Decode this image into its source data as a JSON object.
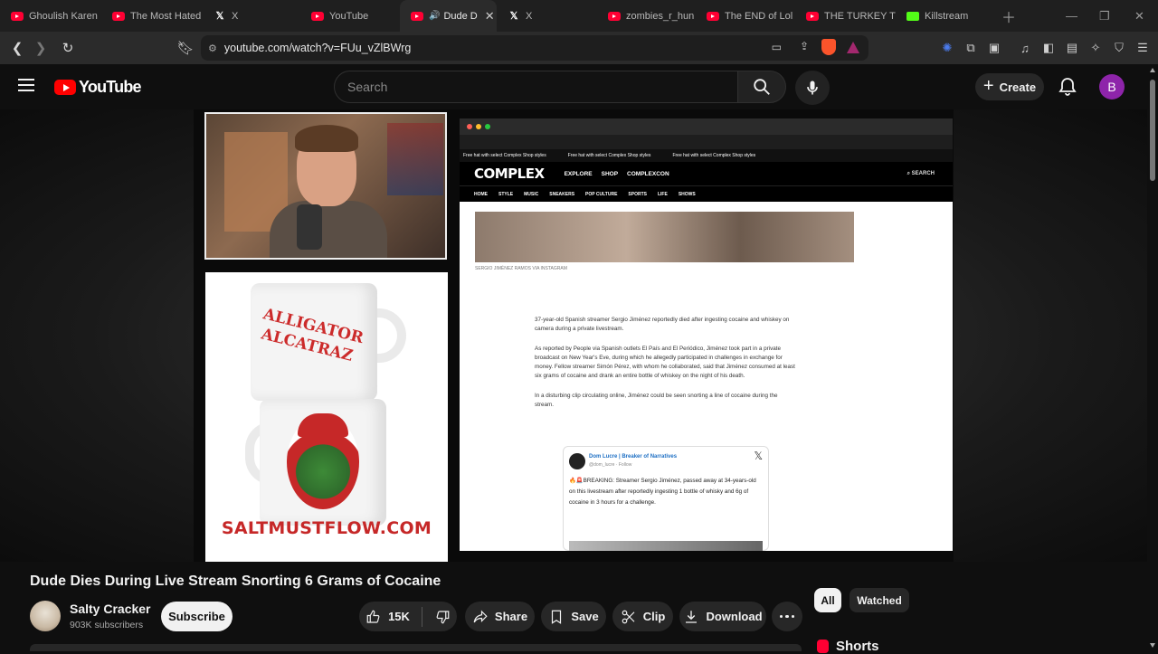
{
  "browser": {
    "tabs": [
      {
        "title": "Ghoulish Karen",
        "icon": "youtube-icon"
      },
      {
        "title": "The Most Hated",
        "icon": "youtube-icon"
      },
      {
        "title": "X",
        "icon": "x-icon"
      },
      {
        "title": "YouTube",
        "icon": "youtube-icon"
      },
      {
        "title": "Dude D",
        "icon": "youtube-icon",
        "active": true
      },
      {
        "title": "X",
        "icon": "x-icon"
      },
      {
        "title": "zombies_r_hun",
        "icon": "youtube-icon"
      },
      {
        "title": "The END of Lol",
        "icon": "youtube-icon"
      },
      {
        "title": "THE TURKEY TC",
        "icon": "youtube-icon"
      },
      {
        "title": "Killstream",
        "icon": "kick-icon"
      }
    ],
    "url": "youtube.com/watch?v=FUu_vZlBWrg"
  },
  "youtube": {
    "logo_text": "YouTube",
    "search_placeholder": "Search",
    "create_label": "Create",
    "avatar_letter": "B"
  },
  "video": {
    "merch_mug_text": "ALLIGATOR ALCATRAZ",
    "merch_url": "SALTMUSTFLOW.COM",
    "inner_page": {
      "site_logo": "COMPLEX",
      "nav_items": [
        "EXPLORE",
        "SHOP",
        "COMPLEXCON"
      ],
      "search_label": "SEARCH",
      "sub_nav": [
        "HOME",
        "STYLE",
        "MUSIC",
        "SNEAKERS",
        "POP CULTURE",
        "SPORTS",
        "LIFE",
        "SHOWS"
      ],
      "promo": "Free hat with select Complex Shop styles",
      "photo_credit": "SERGIO JIMÉNEZ RAMOS VIA INSTAGRAM",
      "paragraphs": [
        "37-year-old Spanish streamer Sergio Jiménez reportedly died after ingesting cocaine and whiskey on camera during a private livestream.",
        "As reported by People via Spanish outlets El País and El Periódico, Jiménez took part in a private broadcast on New Year's Eve, during which he allegedly participated in challenges in exchange for money. Fellow streamer Simón Pérez, with whom he collaborated, said that Jiménez consumed at least six grams of cocaine and drank an entire bottle of whiskey on the night of his death.",
        "In a disturbing clip circulating online, Jiménez could be seen snorting a line of cocaine during the stream."
      ],
      "tweet": {
        "name": "Dom Lucre | Breaker of Narratives",
        "handle": "@dom_lucre · Follow",
        "text": "🔥🚨BREAKING: Streamer Sergio Jiménez, passed away at 34-years-old on this livestream after reportedly ingesting 1 bottle of whisky and 6g of cocaine in 3 hours for a challenge."
      }
    },
    "title": "Dude Dies During Live Stream Snorting 6 Grams of Cocaine",
    "channel": {
      "name": "Salty Cracker",
      "subscribers": "903K subscribers",
      "subscribe_label": "Subscribe"
    },
    "actions": {
      "likes": "15K",
      "share": "Share",
      "save": "Save",
      "clip": "Clip",
      "download": "Download"
    }
  },
  "sidebar": {
    "chips": [
      "All",
      "Watched"
    ],
    "shorts_label": "Shorts"
  }
}
